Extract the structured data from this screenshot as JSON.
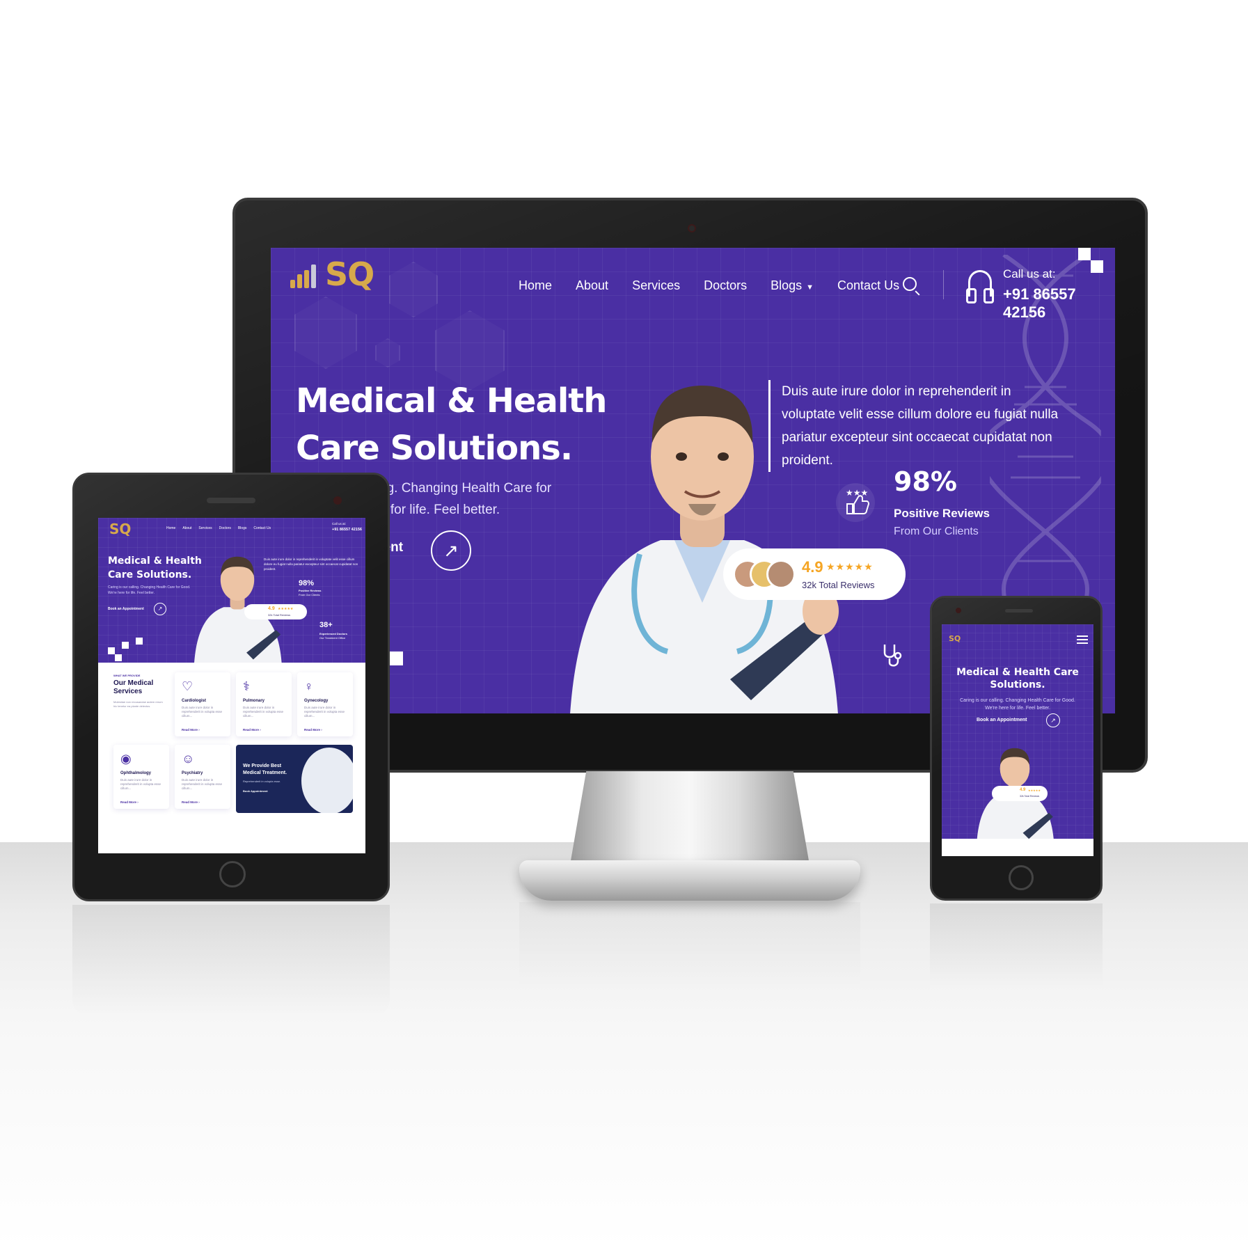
{
  "site": {
    "logo_text": "SQ",
    "nav": [
      "Home",
      "About",
      "Services",
      "Doctors",
      "Blogs",
      "Contact Us"
    ],
    "call_label": "Call us at:",
    "call_number": "+91 86557 42156",
    "hero_title_line1": "Medical & Health",
    "hero_title_line2": "Care Solutions.",
    "hero_title_single": "Medical & Health Care Solutions.",
    "hero_sub_desktop_line1": "ng. Changing Health Care for",
    "hero_sub_desktop_line2": "e for life. Feel better.",
    "hero_sub_full": "Caring is our calling. Changing Health Care for Good. We're here for life. Feel better.",
    "cta_desktop": "nent",
    "cta": "Book an Appointment",
    "quote": "Duis aute irure dolor in reprehenderit in voluptate velit esse cillum dolore eu fugiat nulla pariatur excepteur sint occaecat cupidatat non proident.",
    "stat1_value": "98%",
    "stat1_label": "Positive Reviews",
    "stat1_sub": "From Our Clients",
    "stat2_value": "38+",
    "stat2_label": "Experienced Doctors",
    "stat2_sub": "Our Treatment Office",
    "rating": "4.9",
    "stars": "★★★★★",
    "reviews": "32k Total Reviews",
    "arrow": "↗"
  },
  "services": {
    "kicker": "WHAT WE PROVIDE",
    "title": "Our Medical Services",
    "desc": "Molestiae non recusandae autem rerum hic tenetur ea plante delectus.",
    "read_more": "Read More ›",
    "card_desc": "Duis aute irure dolor in reprehenderit in volupta esse cillum...",
    "items": [
      {
        "name": "Cardiologist",
        "icon": "heart-icon"
      },
      {
        "name": "Pulmonary",
        "icon": "lungs-icon"
      },
      {
        "name": "Gynecology",
        "icon": "uterus-icon"
      },
      {
        "name": "Ophthalmology",
        "icon": "eye-icon"
      },
      {
        "name": "Psychiatry",
        "icon": "brain-icon"
      }
    ],
    "promo_title": "We Provide Best Medical Treatment.",
    "promo_text": "Reprehenderit in volupta esse.",
    "promo_cta": "Book Appointment"
  },
  "colors": {
    "brand_purple": "#4a2fa3",
    "gold": "#d7a94b",
    "star": "#f5a524",
    "navy": "#1b2659"
  }
}
